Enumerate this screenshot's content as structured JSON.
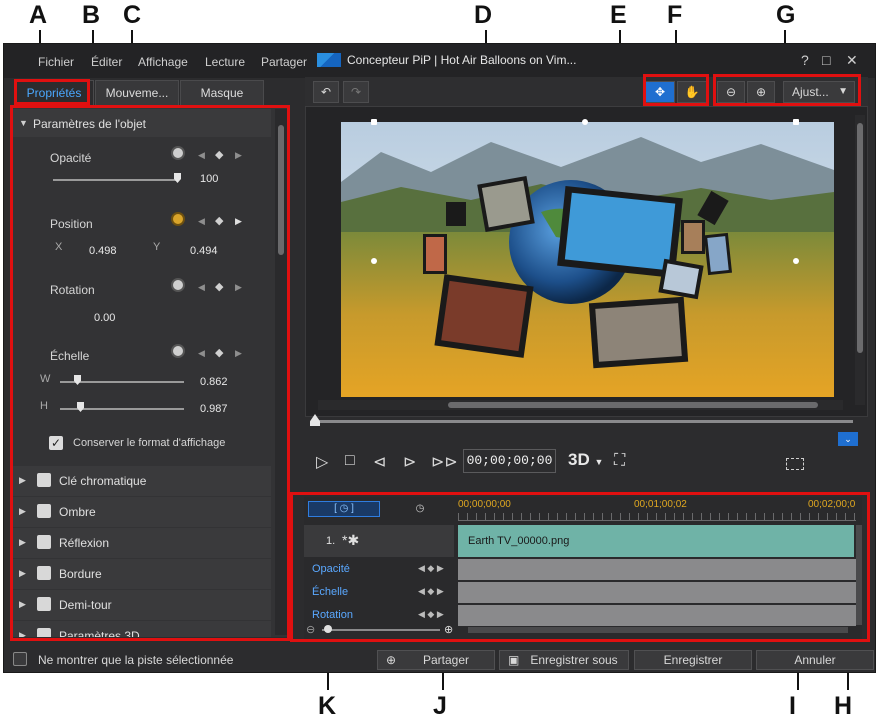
{
  "callouts": [
    "A",
    "B",
    "C",
    "D",
    "E",
    "F",
    "G",
    "H",
    "I",
    "J",
    "K"
  ],
  "menu": {
    "fichier": "Fichier",
    "editer": "Éditer",
    "affichage": "Affichage",
    "lecture": "Lecture",
    "partager": "Partager"
  },
  "window": {
    "title": "Concepteur PiP | Hot Air Balloons on Vim...",
    "help": "?",
    "maximize": "□",
    "close": "✕"
  },
  "tabs": {
    "proprietes": "Propriétés",
    "mouvement": "Mouveme...",
    "masque": "Masque"
  },
  "params": {
    "header": "Paramètres de l'objet",
    "opacity_label": "Opacité",
    "opacity_value": "100",
    "opacity_fraction": 1.0,
    "position_label": "Position",
    "x_label": "X",
    "x_value": "0.498",
    "y_label": "Y",
    "y_value": "0.494",
    "rotation_label": "Rotation",
    "rotation_value": "0.00",
    "scale_label": "Échelle",
    "w_label": "W",
    "w_value": "0.862",
    "h_label": "H",
    "h_value": "0.987",
    "keep_aspect": "Conserver le format d'affichage"
  },
  "sections": [
    "Clé chromatique",
    "Ombre",
    "Réflexion",
    "Bordure",
    "Demi-tour",
    "Paramètres 3D"
  ],
  "toolbar": {
    "fit": "Ajust..."
  },
  "player": {
    "timecode": "00;00;00;00",
    "mode_3d": "3D"
  },
  "timeline": {
    "ruler": [
      "00;00;00;00",
      "00;01;00;02",
      "00;02;00;0"
    ],
    "track_label": "1.",
    "clip_name": "Earth TV_00000.png",
    "attrs": [
      "Opacité",
      "Échelle",
      "Rotation"
    ]
  },
  "bottom": {
    "only_selected": "Ne montrer que la piste sélectionnée",
    "share": "Partager",
    "save_as": "Enregistrer sous",
    "save": "Enregistrer",
    "cancel": "Annuler"
  },
  "colors": {
    "accent": "#1f6fd0",
    "highlight_red": "#e01010",
    "tab_active": "#4aa8ff",
    "clip": "#6fb3a7"
  }
}
